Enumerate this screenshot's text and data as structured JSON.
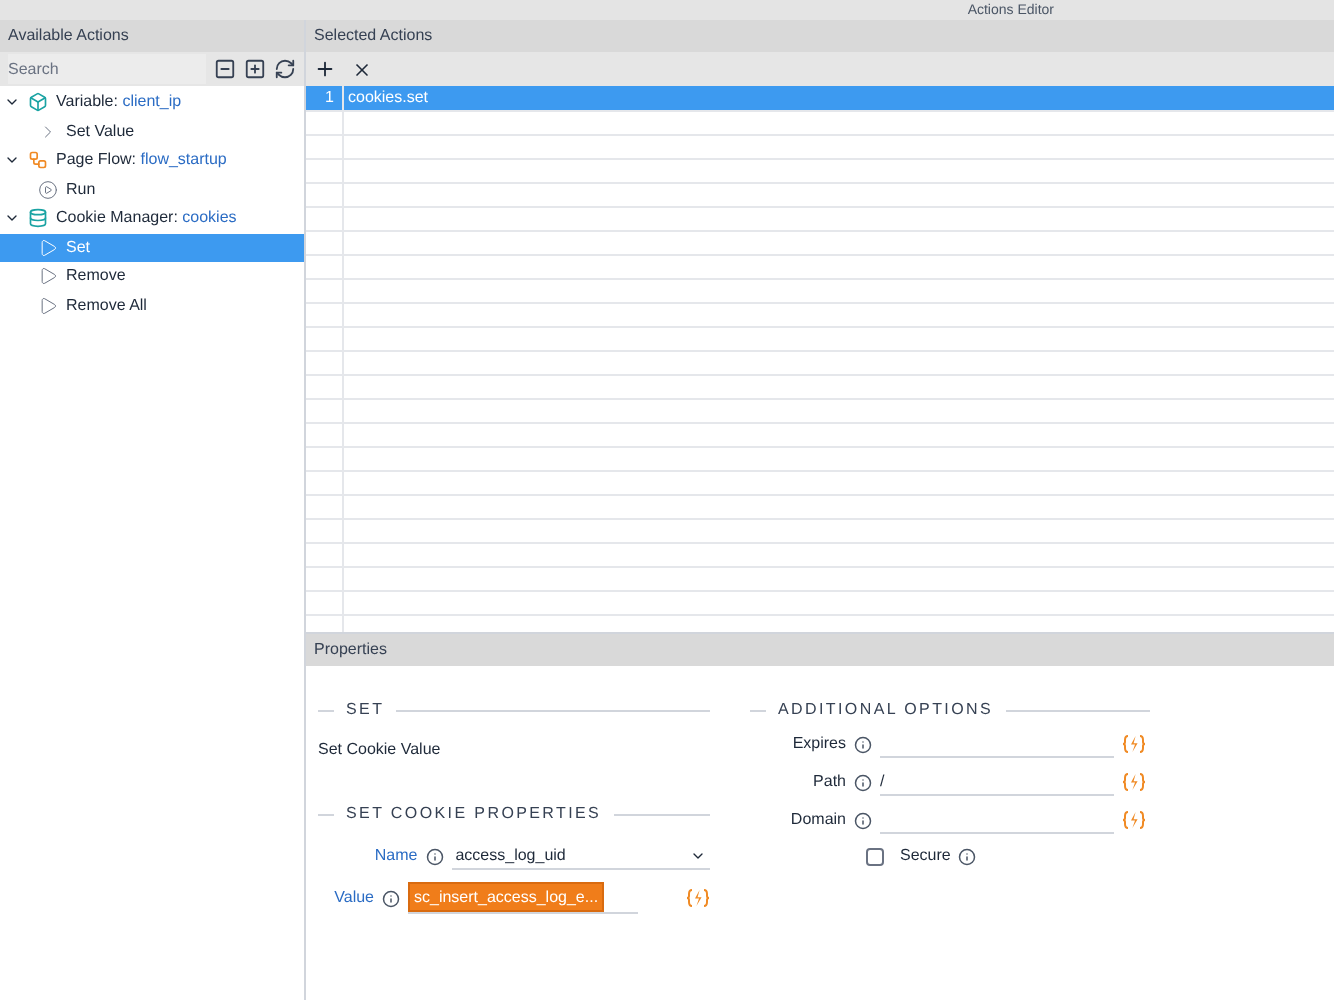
{
  "window": {
    "title": "Actions Editor"
  },
  "available_actions": {
    "title": "Available Actions",
    "search": {
      "placeholder": "Search"
    },
    "tree": [
      {
        "kind": "variable",
        "label": "Variable: ",
        "name": "client_ip",
        "expanded": true,
        "selected": false,
        "children": [
          {
            "kind": "property",
            "label": "Set Value",
            "selected": false
          }
        ]
      },
      {
        "kind": "flow",
        "label": "Page Flow: ",
        "name": "flow_startup",
        "expanded": true,
        "selected": false,
        "children": [
          {
            "kind": "run",
            "label": "Run",
            "selected": false
          }
        ]
      },
      {
        "kind": "cookie",
        "label": "Cookie Manager: ",
        "name": "cookies",
        "expanded": true,
        "selected": false,
        "children": [
          {
            "kind": "action",
            "label": "Set",
            "selected": true
          },
          {
            "kind": "action",
            "label": "Remove",
            "selected": false
          },
          {
            "kind": "action",
            "label": "Remove All",
            "selected": false
          }
        ]
      }
    ]
  },
  "selected_actions": {
    "title": "Selected Actions",
    "rows": [
      {
        "number": "1",
        "action": "cookies.set",
        "selected": true
      }
    ]
  },
  "properties": {
    "title": "Properties",
    "set": {
      "heading": "SET",
      "description": "Set Cookie Value"
    },
    "cookie_properties": {
      "heading": "SET COOKIE PROPERTIES",
      "fields": [
        {
          "kind": "dropdown",
          "label": "Name",
          "value": "access_log_uid"
        },
        {
          "kind": "highlighted",
          "label": "Value",
          "value": "sc_insert_access_log_e..."
        }
      ]
    },
    "additional_options": {
      "heading": "ADDITIONAL OPTIONS",
      "fields": [
        {
          "label": "Expires"
        },
        {
          "label": "Path",
          "value": "/"
        },
        {
          "label": "Domain"
        }
      ],
      "secure": {
        "label": "Secure",
        "checked": false
      }
    }
  }
}
